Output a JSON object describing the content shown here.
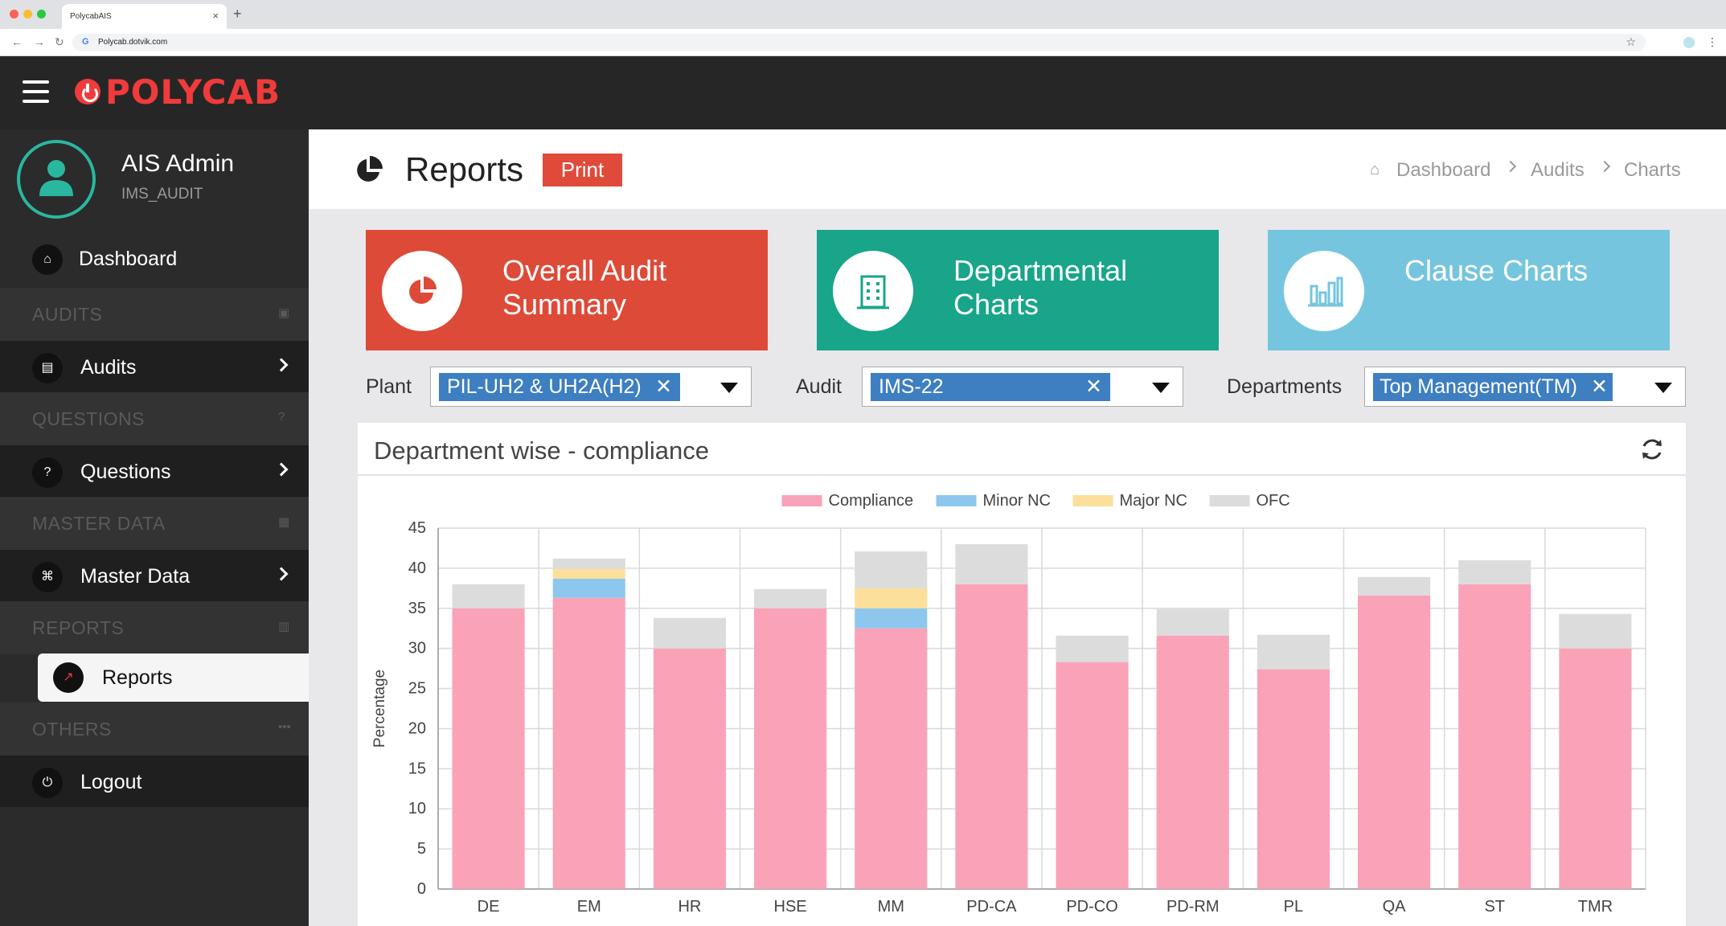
{
  "browser": {
    "tab_title": "PolycabAIS",
    "tab_close": "×",
    "new_tab": "+",
    "url": "Polycab.dotvik.com"
  },
  "brand": {
    "logo_text": "POLYCAB",
    "color": "#ef3b3b"
  },
  "user": {
    "name": "AIS Admin",
    "role": "IMS_AUDIT"
  },
  "sidebar": {
    "dashboard": "Dashboard",
    "sections": {
      "audits": "AUDITS",
      "questions": "QUESTIONS",
      "master_data": "MASTER DATA",
      "reports": "REPORTS",
      "others": "OTHERS"
    },
    "items": {
      "audits": "Audits",
      "questions": "Questions",
      "master_data": "Master Data",
      "reports": "Reports",
      "logout": "Logout"
    }
  },
  "page": {
    "title": "Reports",
    "print_label": "Print",
    "breadcrumb": [
      "Dashboard",
      "Audits",
      "Charts"
    ]
  },
  "cards": [
    {
      "title": "Overall Audit Summary",
      "color": "#dd4a38",
      "icon": "pie-icon"
    },
    {
      "title": "Departmental Charts",
      "color": "#18a58a",
      "icon": "building-icon"
    },
    {
      "title": "Clause Charts",
      "color": "#76c5df",
      "icon": "bar-chart-icon"
    }
  ],
  "filters": {
    "plant": {
      "label": "Plant",
      "value": "PIL-UH2 & UH2A(H2)"
    },
    "audit": {
      "label": "Audit",
      "value": "IMS-22"
    },
    "departments": {
      "label": "Departments",
      "value": "Top Management(TM)"
    }
  },
  "panel": {
    "title": "Department wise - compliance"
  },
  "chart_data": {
    "type": "bar",
    "stacked": true,
    "categories": [
      "DE",
      "EM",
      "HR",
      "HSE",
      "MM",
      "PD-CA",
      "PD-CO",
      "PD-RM",
      "PL",
      "QA",
      "ST",
      "TMR"
    ],
    "series": [
      {
        "name": "Compliance",
        "color": "#f9a2b8",
        "values": [
          35,
          36.3,
          30,
          35,
          32.5,
          38,
          28.3,
          31.6,
          27.4,
          36.6,
          38,
          30
        ]
      },
      {
        "name": "Minor NC",
        "color": "#8ec7ee",
        "values": [
          0,
          2.4,
          0,
          0,
          2.5,
          0,
          0,
          0,
          0,
          0,
          0,
          0
        ]
      },
      {
        "name": "Major NC",
        "color": "#fcdf9a",
        "values": [
          0,
          1.2,
          0,
          0,
          2.5,
          0,
          0,
          0,
          0,
          0,
          0,
          0
        ]
      },
      {
        "name": "OFC",
        "color": "#dcdcdc",
        "values": [
          3,
          1.3,
          3.8,
          2.4,
          4.6,
          5,
          3.3,
          3.3,
          4.3,
          2.3,
          3,
          4.3
        ]
      }
    ],
    "ylabel": "Percentage",
    "ylim": [
      0,
      45
    ],
    "yticks": [
      0,
      5,
      10,
      15,
      20,
      25,
      30,
      35,
      40,
      45
    ],
    "grid": true,
    "legend": "top"
  }
}
